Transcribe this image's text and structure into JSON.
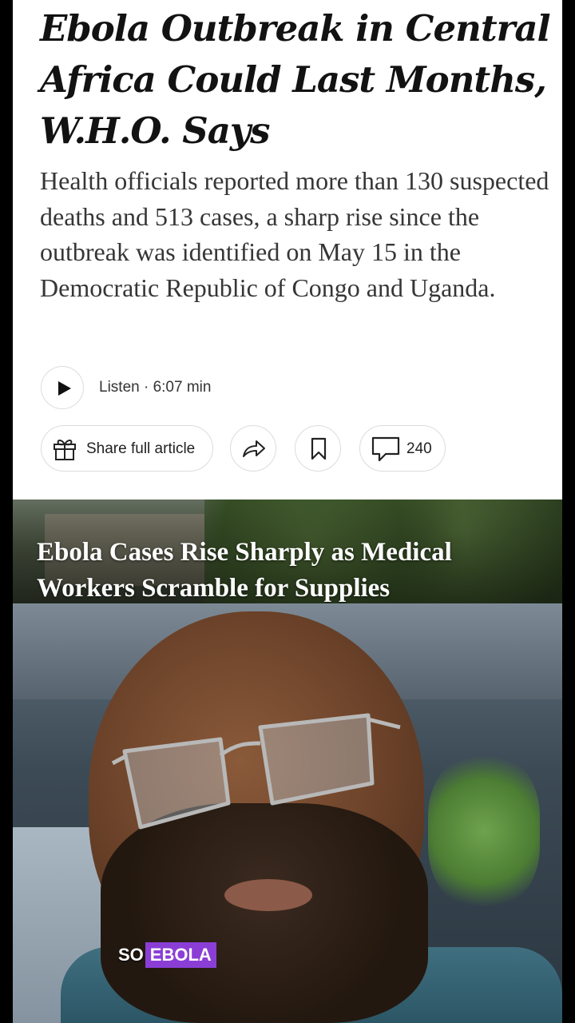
{
  "article": {
    "headline": "Ebola Outbreak in Central Africa Could Last Months, W.H.O. Says",
    "summary": "Health officials reported more than 130 suspected deaths and 513 cases, a sharp rise since the outbreak was identified on May 15 in the Democratic Republic of Congo and Uganda.",
    "listen_text": "Listen · 6:07 min",
    "share_label": "Share full article",
    "comment_count": "240",
    "icons": {
      "play": "play-icon",
      "gift": "gift-icon",
      "forward": "forward-arrow-icon",
      "bookmark": "bookmark-icon",
      "comment": "comment-bubble-icon"
    }
  },
  "hero": {
    "caption": "Ebola Cases Rise Sharply as Medical Workers Scramble for Supplies"
  },
  "video": {
    "caption_word1": "SO",
    "caption_word2": "EBOLA",
    "highlight_color": "#8b3ed6"
  }
}
